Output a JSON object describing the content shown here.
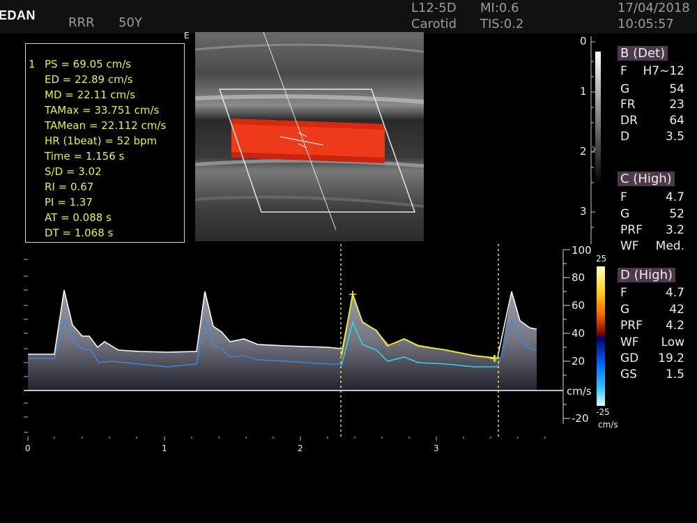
{
  "header": {
    "logo": "EDAN",
    "patient_name": "RRR",
    "patient_age": "50Y",
    "probe": "L12-5D",
    "preset": "Carotid",
    "mi": "MI:0.6",
    "tis": "TIS:0.2",
    "date": "17/04/2018",
    "time": "10:05:57"
  },
  "image": {
    "edge_marker": "E"
  },
  "measurements": {
    "index": "1",
    "items": [
      "PS = 69.05 cm/s",
      "ED = 22.89 cm/s",
      "MD = 22.11 cm/s",
      "TAMax = 33.751 cm/s",
      "TAMean = 22.112 cm/s",
      "HR (1beat) = 52 bpm",
      "Time = 1.156 s",
      "S/D = 3.02",
      "RI = 0.67",
      "PI = 1.37",
      "AT = 0.088 s",
      "DT = 1.068 s"
    ]
  },
  "depth_scale": {
    "labels": [
      "0",
      "1",
      "2",
      "3"
    ]
  },
  "color_scale": {
    "top": "25",
    "bottom": "-25",
    "unit": "cm/s"
  },
  "params": {
    "b_mode": {
      "title": "B (Det)",
      "rows": [
        [
          "F",
          "H7~12"
        ],
        [
          "G",
          "54"
        ],
        [
          "FR",
          "23"
        ],
        [
          "DR",
          "64"
        ],
        [
          "D",
          "3.5"
        ]
      ]
    },
    "c_mode": {
      "title": "C (High)",
      "rows": [
        [
          "F",
          "4.7"
        ],
        [
          "G",
          "52"
        ],
        [
          "PRF",
          "3.2"
        ],
        [
          "WF",
          "Med."
        ]
      ]
    },
    "d_mode": {
      "title": "D (High)",
      "rows": [
        [
          "F",
          "4.7"
        ],
        [
          "G",
          "42"
        ],
        [
          "PRF",
          "4.2"
        ],
        [
          "WF",
          "Low"
        ],
        [
          "GD",
          "19.2"
        ],
        [
          "GS",
          "1.5"
        ]
      ]
    }
  },
  "spectrum": {
    "velocity_labels": [
      "100",
      "80",
      "60",
      "40",
      "20",
      "-20"
    ],
    "unit_label": "cm/s",
    "time_labels": [
      "0",
      "1",
      "2",
      "3"
    ]
  }
}
